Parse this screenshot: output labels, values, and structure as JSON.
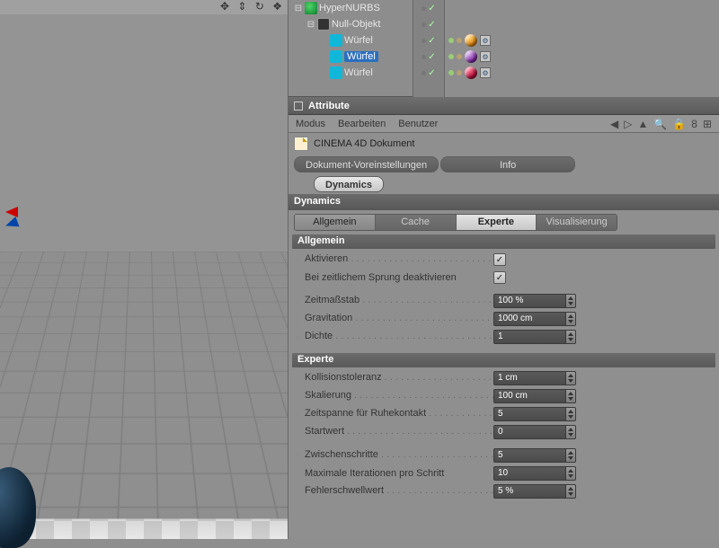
{
  "viewport": {
    "toolbar_icons": [
      "✥",
      "⇕",
      "↻",
      "❖"
    ]
  },
  "object_tree": {
    "rows": [
      {
        "name": "HyperNURBS",
        "toggle": "⊟",
        "icon": "ic-hn",
        "indent": 0,
        "sel": false
      },
      {
        "name": "Null-Objekt",
        "toggle": "⊟",
        "icon": "ic-null",
        "indent": 1,
        "sel": false
      },
      {
        "name": "Würfel",
        "toggle": "",
        "icon": "ic-cube",
        "indent": 2,
        "sel": false
      },
      {
        "name": "Würfel",
        "toggle": "",
        "icon": "ic-cube",
        "indent": 2,
        "sel": true
      },
      {
        "name": "Würfel",
        "toggle": "",
        "icon": "ic-cube",
        "indent": 2,
        "sel": false
      }
    ],
    "tag_spheres": [
      "s1",
      "s2",
      "s3"
    ]
  },
  "attribute": {
    "title": "Attribute",
    "menu": {
      "modus": "Modus",
      "bearbeiten": "Bearbeiten",
      "benutzer": "Benutzer"
    },
    "doc_name": "CINEMA 4D Dokument",
    "pills": {
      "voreinst": "Dokument-Voreinstellungen",
      "info": "Info",
      "dynamics": "Dynamics"
    },
    "section": "Dynamics",
    "tabs": {
      "allgemein": "Allgemein",
      "cache": "Cache",
      "experte": "Experte",
      "visualisierung": "Visualisierung"
    },
    "group_allgemein": "Allgemein",
    "group_experte": "Experte",
    "params": {
      "aktivieren": "Aktivieren",
      "bei_sprung": "Bei zeitlichem Sprung deaktivieren",
      "zeitmassstab": "Zeitmaßstab",
      "zeitmassstab_v": "100 %",
      "gravitation": "Gravitation",
      "gravitation_v": "1000 cm",
      "dichte": "Dichte",
      "dichte_v": "1",
      "kollisionstoleranz": "Kollisionstoleranz",
      "kollisionstoleranz_v": "1 cm",
      "skalierung": "Skalierung",
      "skalierung_v": "100 cm",
      "zeitspanne": "Zeitspanne für Ruhekontakt",
      "zeitspanne_v": "5",
      "startwert": "Startwert",
      "startwert_v": "0",
      "zwischenschritte": "Zwischenschritte",
      "zwischenschritte_v": "5",
      "max_iter": "Maximale Iterationen pro Schritt",
      "max_iter_v": "10",
      "fehler": "Fehlerschwellwert",
      "fehler_v": "5 %"
    }
  }
}
